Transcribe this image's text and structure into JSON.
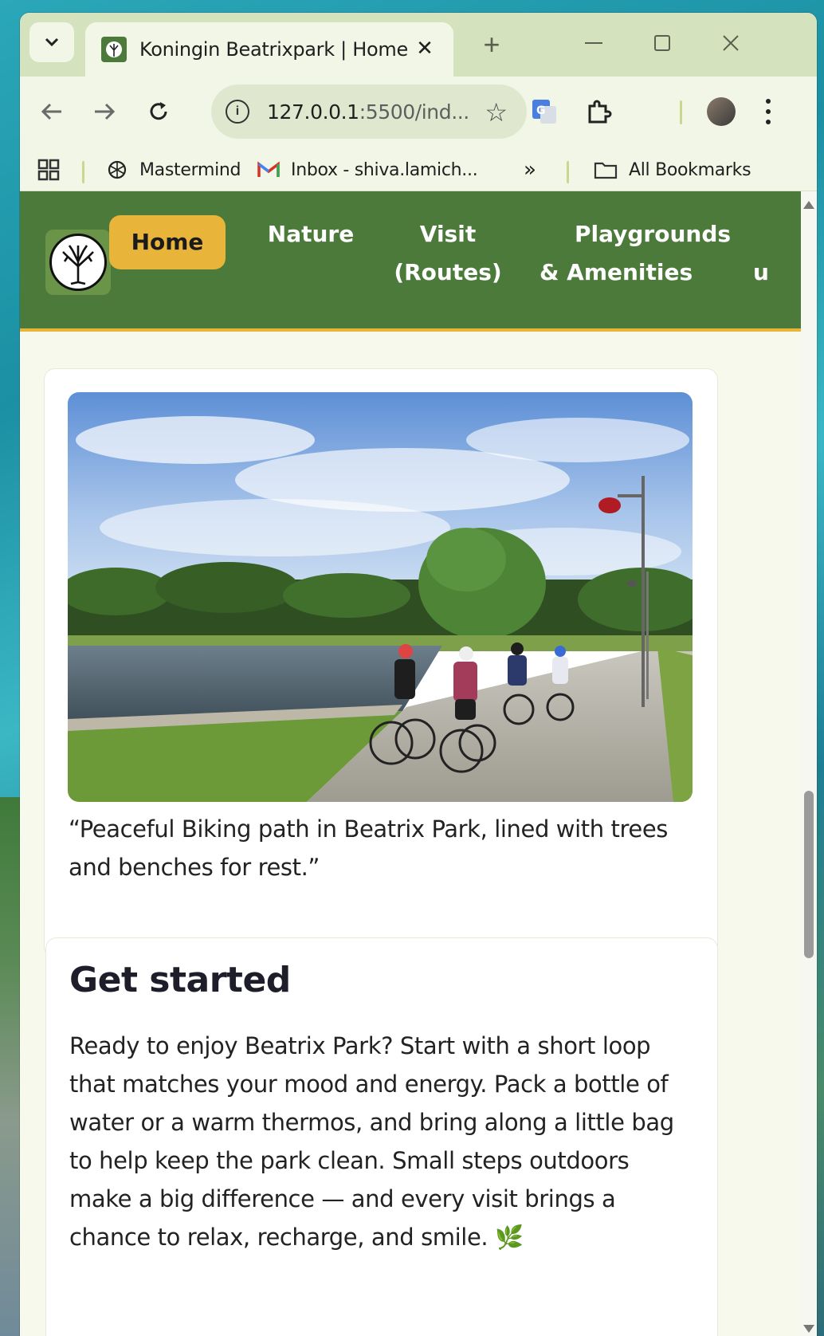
{
  "browser": {
    "tab": {
      "title": "Koningin Beatrixpark | Home"
    },
    "address": {
      "host": "127.0.0.1",
      "rest": ":5500/ind..."
    },
    "bookmarks": [
      {
        "label": "Mastermind"
      },
      {
        "label": "Inbox - shiva.lamich..."
      }
    ],
    "all_bookmarks_label": "All Bookmarks"
  },
  "site": {
    "nav": [
      {
        "line1": "Home",
        "line2": ""
      },
      {
        "line1": "Nature",
        "line2": ""
      },
      {
        "line1": "Visit",
        "line2": "(Routes)"
      },
      {
        "line1": "Playgrounds",
        "line2": "& Amenities"
      }
    ],
    "nav_overflow_char": "u"
  },
  "main": {
    "photo_caption": "“Peaceful Biking path in Beatrix Park, lined with trees and benches for rest.”",
    "get_started": {
      "title": "Get started",
      "body": "Ready to enjoy Beatrix Park? Start with a short loop that matches your mood and energy. Pack a bottle of water or a warm thermos, and bring along a little bag to help keep the park clean. Small steps outdoors make a big difference — and every visit brings a chance to relax, recharge, and smile. 🌿"
    }
  },
  "colors": {
    "header_bg": "#4c7a3a",
    "accent": "#e8b43a",
    "page_bg": "#f6f9ec"
  }
}
